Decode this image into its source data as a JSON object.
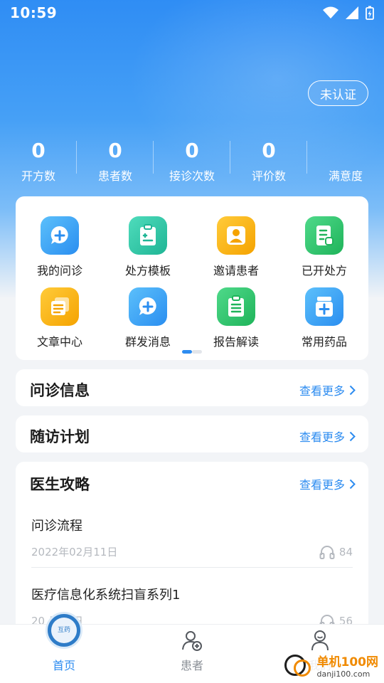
{
  "status_bar": {
    "time": "10:59"
  },
  "header": {
    "cert_button": "未认证"
  },
  "stats": [
    {
      "value": "0",
      "label": "开方数"
    },
    {
      "value": "0",
      "label": "患者数"
    },
    {
      "value": "0",
      "label": "接诊次数"
    },
    {
      "value": "0",
      "label": "评价数"
    },
    {
      "value": "",
      "label": "满意度"
    }
  ],
  "quick_actions": [
    {
      "label": "我的问诊",
      "icon": "chat-plus-icon",
      "color": "#39a3f5"
    },
    {
      "label": "处方模板",
      "icon": "clipboard-icon",
      "color": "#2dc5a5"
    },
    {
      "label": "邀请患者",
      "icon": "person-card-icon",
      "color": "#f7b216"
    },
    {
      "label": "已开处方",
      "icon": "document-icon",
      "color": "#2ec36b"
    },
    {
      "label": "文章中心",
      "icon": "articles-icon",
      "color": "#f7b216"
    },
    {
      "label": "群发消息",
      "icon": "chat-plus-icon",
      "color": "#39a3f5"
    },
    {
      "label": "报告解读",
      "icon": "report-icon",
      "color": "#2ec36b"
    },
    {
      "label": "常用药品",
      "icon": "medicine-icon",
      "color": "#39a3f5"
    }
  ],
  "sections": {
    "inquiry": {
      "title": "问诊信息",
      "more": "查看更多"
    },
    "followup": {
      "title": "随访计划",
      "more": "查看更多"
    },
    "guide": {
      "title": "医生攻略",
      "more": "查看更多",
      "articles": [
        {
          "title": "问诊流程",
          "date": "2022年02月11日",
          "listens": "84"
        },
        {
          "title": "医疗信息化系统扫盲系列1",
          "date": "20  月12日",
          "listens": "56"
        }
      ]
    }
  },
  "tabbar": {
    "home": "首页",
    "patients": "患者",
    "mine": "我的",
    "logo_text": "互药"
  },
  "watermark": {
    "cn": "单机100网",
    "en": "danji100.com"
  },
  "colors": {
    "accent": "#2d8cf0"
  }
}
